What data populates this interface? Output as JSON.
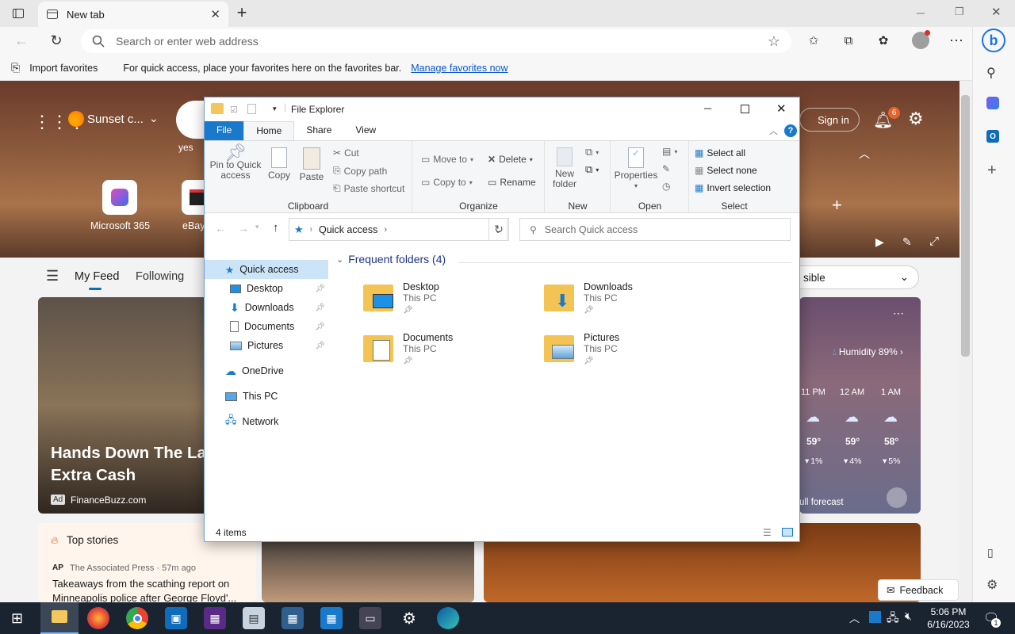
{
  "browser": {
    "tab_title": "New tab",
    "omnibox_placeholder": "Search or enter web address",
    "favbar": {
      "import_label": "Import favorites",
      "message": "For quick access, place your favorites here on the favorites bar.",
      "manage_link": "Manage favorites now"
    }
  },
  "page": {
    "location": "Sunset c...",
    "search_hint": "yes",
    "quick_links": [
      "Microsoft 365",
      "eBay"
    ],
    "sign_in": "Sign in",
    "notification_count": "6",
    "feed_tabs": [
      "My Feed",
      "Following"
    ],
    "content_dropdown": "sible",
    "card_headline": "Hands Down The La Extra Cash",
    "card_ad_badge": "Ad",
    "card_source": "FinanceBuzz.com",
    "top_stories_title": "Top stories",
    "story_source": "The Associated Press · 57m ago",
    "story_headline": "Takeaways from the scathing report on Minneapolis police after George Floyd'...",
    "weather": {
      "humidity": "Humidity 89%",
      "hours": [
        {
          "time": "11 PM",
          "temp": "59°",
          "precip": "1%"
        },
        {
          "time": "12 AM",
          "temp": "59°",
          "precip": "4%"
        },
        {
          "time": "1 AM",
          "temp": "58°",
          "precip": "5%"
        }
      ],
      "forecast_link": "ull forecast"
    },
    "feedback": "Feedback"
  },
  "explorer": {
    "title": "File Explorer",
    "ribbon_tabs": [
      "File",
      "Home",
      "Share",
      "View"
    ],
    "clipboard": {
      "pin": "Pin to Quick access",
      "copy": "Copy",
      "paste": "Paste",
      "cut": "Cut",
      "copy_path": "Copy path",
      "paste_shortcut": "Paste shortcut",
      "label": "Clipboard"
    },
    "organize": {
      "move_to": "Move to",
      "copy_to": "Copy to",
      "delete": "Delete",
      "rename": "Rename",
      "label": "Organize"
    },
    "new": {
      "new_folder": "New folder",
      "label": "New"
    },
    "open": {
      "properties": "Properties",
      "label": "Open"
    },
    "select": {
      "select_all": "Select all",
      "select_none": "Select none",
      "invert": "Invert selection",
      "label": "Select"
    },
    "address": "Quick access",
    "search_placeholder": "Search Quick access",
    "nav": {
      "quick_access": "Quick access",
      "desktop": "Desktop",
      "downloads": "Downloads",
      "documents": "Documents",
      "pictures": "Pictures",
      "onedrive": "OneDrive",
      "this_pc": "This PC",
      "network": "Network"
    },
    "section_title": "Frequent folders (4)",
    "folders": [
      {
        "name": "Desktop",
        "location": "This PC"
      },
      {
        "name": "Downloads",
        "location": "This PC"
      },
      {
        "name": "Documents",
        "location": "This PC"
      },
      {
        "name": "Pictures",
        "location": "This PC"
      }
    ],
    "status": "4 items"
  },
  "taskbar": {
    "time": "5:06 PM",
    "date": "6/16/2023",
    "notification_badge": "1"
  }
}
